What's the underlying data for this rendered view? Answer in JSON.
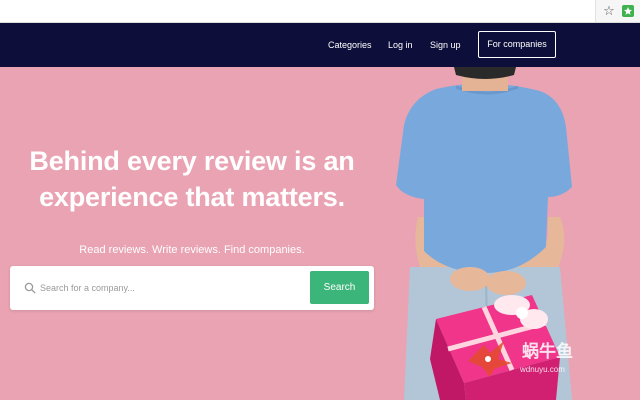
{
  "browser": {
    "star_icon": "star-icon",
    "extension_icon": "extension-icon"
  },
  "nav": {
    "links": [
      {
        "label": "Categories"
      },
      {
        "label": "Log in"
      },
      {
        "label": "Sign up"
      }
    ],
    "cta": {
      "label": "For companies"
    }
  },
  "hero": {
    "headline_lines": [
      "Behind every review is an",
      "experience that matters."
    ],
    "subline": "Read reviews. Write reviews. Find companies.",
    "search": {
      "placeholder": "Search for a company...",
      "value": "",
      "button_label": "Search"
    },
    "colors": {
      "background": "#eaa3b3",
      "nav": "#0e0e3a",
      "button": "#3bb579"
    }
  },
  "watermark": {
    "text_cn": "蜗牛鱼",
    "url": "wdnuyu.com"
  }
}
